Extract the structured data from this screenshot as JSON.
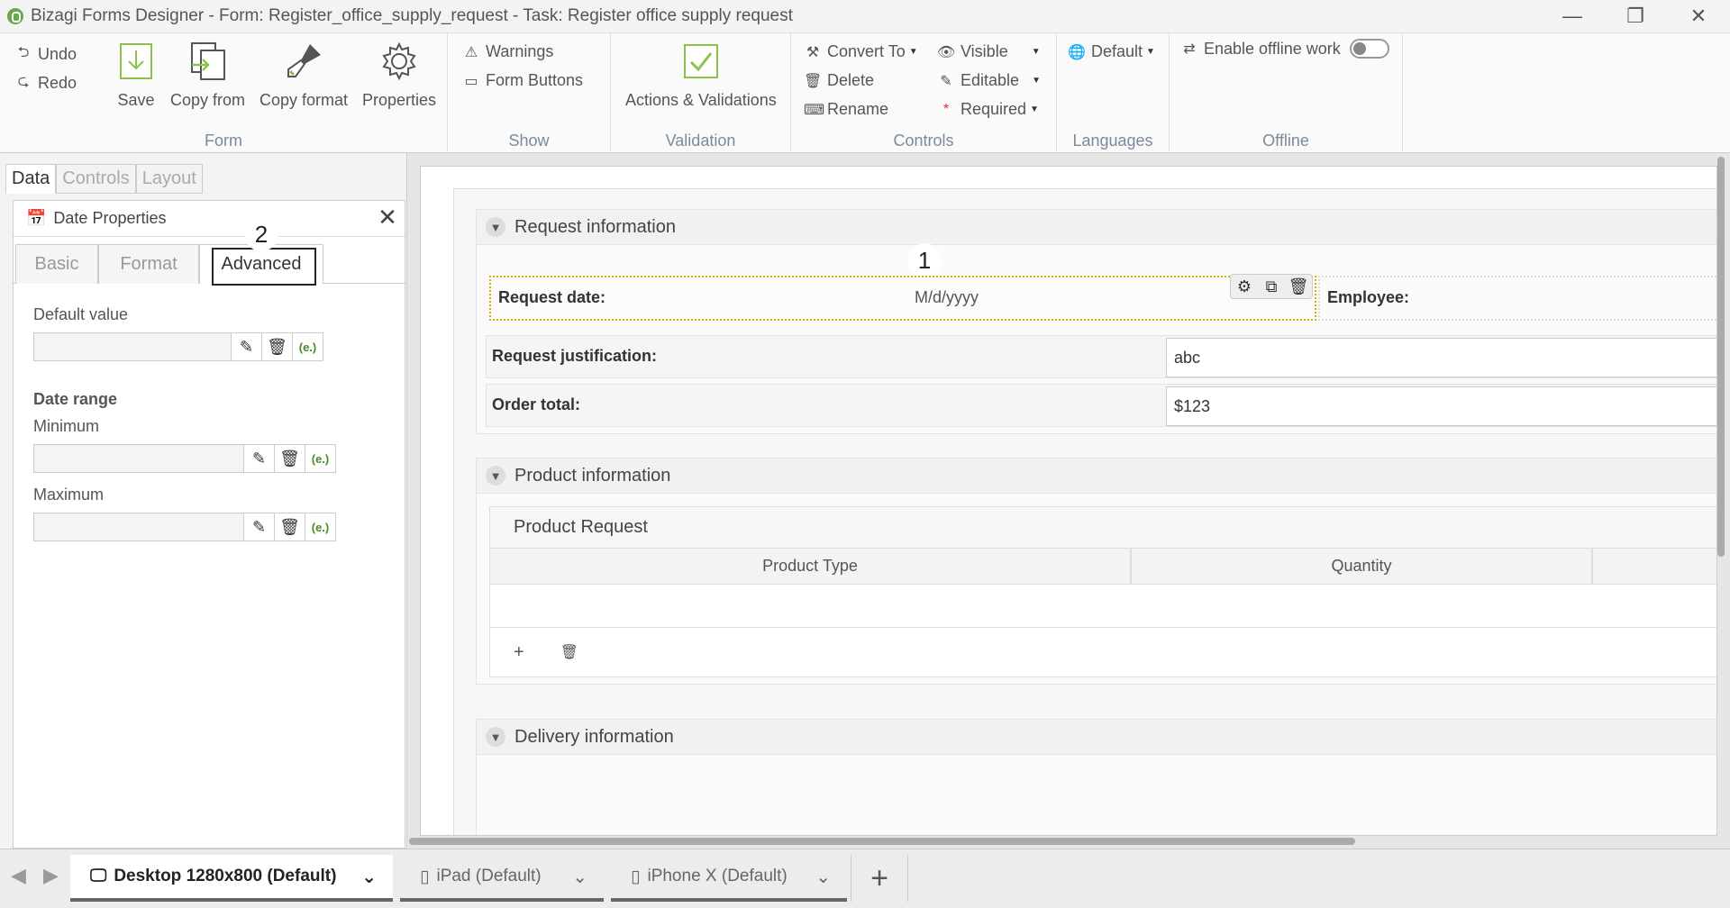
{
  "window": {
    "title": "Bizagi Forms Designer  - Form: Register_office_supply_request - Task:  Register office supply request",
    "minimize": "—",
    "restore": "❐",
    "close": "✕"
  },
  "ribbon": {
    "form": {
      "label": "Form",
      "undo": "Undo",
      "redo": "Redo",
      "save": "Save",
      "copy_from": "Copy from",
      "copy_format": "Copy format",
      "properties": "Properties"
    },
    "show": {
      "label": "Show",
      "warnings": "Warnings",
      "form_buttons": "Form Buttons"
    },
    "validation": {
      "label": "Validation",
      "actions": "Actions & Validations"
    },
    "controls": {
      "label": "Controls",
      "convert_to": "Convert To",
      "delete": "Delete",
      "rename": "Rename",
      "visible": "Visible",
      "editable": "Editable",
      "required": "Required"
    },
    "languages": {
      "label": "Languages",
      "default": "Default"
    },
    "offline": {
      "label": "Offline",
      "enable": "Enable offline work",
      "enabled": false
    }
  },
  "left_panel": {
    "tabs": [
      "Data",
      "Controls",
      "Layout"
    ],
    "active_tab": "Data",
    "date_properties": {
      "title": "Date Properties",
      "tabs": [
        "Basic",
        "Format",
        "Advanced"
      ],
      "active_tab": "Advanced",
      "default_value_label": "Default value",
      "date_range_label": "Date range",
      "minimum_label": "Minimum",
      "maximum_label": "Maximum",
      "expr_label": "(e.)"
    }
  },
  "markers": {
    "one": "1",
    "two": "2"
  },
  "form": {
    "request_info": {
      "title": "Request information",
      "request_date_label": "Request date:",
      "request_date_value": "M/d/yyyy",
      "employee_label": "Employee:",
      "justification_label": "Request justification:",
      "justification_value": "abc",
      "order_total_label": "Order total:",
      "order_total_value": "$123"
    },
    "product_info": {
      "title": "Product information",
      "grid_title": "Product Request",
      "columns": [
        "Product Type",
        "Quantity"
      ],
      "add": "+",
      "delete": "🗑"
    },
    "delivery_info": {
      "title": "Delivery information"
    }
  },
  "bottom": {
    "tabs": [
      {
        "label": "Desktop 1280x800 (Default)"
      },
      {
        "label": "iPad (Default)"
      },
      {
        "label": "iPhone X (Default)"
      }
    ],
    "active": "Desktop 1280x800 (Default)",
    "add": "+"
  },
  "colors": {
    "accent_green": "#6aa84f",
    "selection_yellow": "#e0b000"
  }
}
